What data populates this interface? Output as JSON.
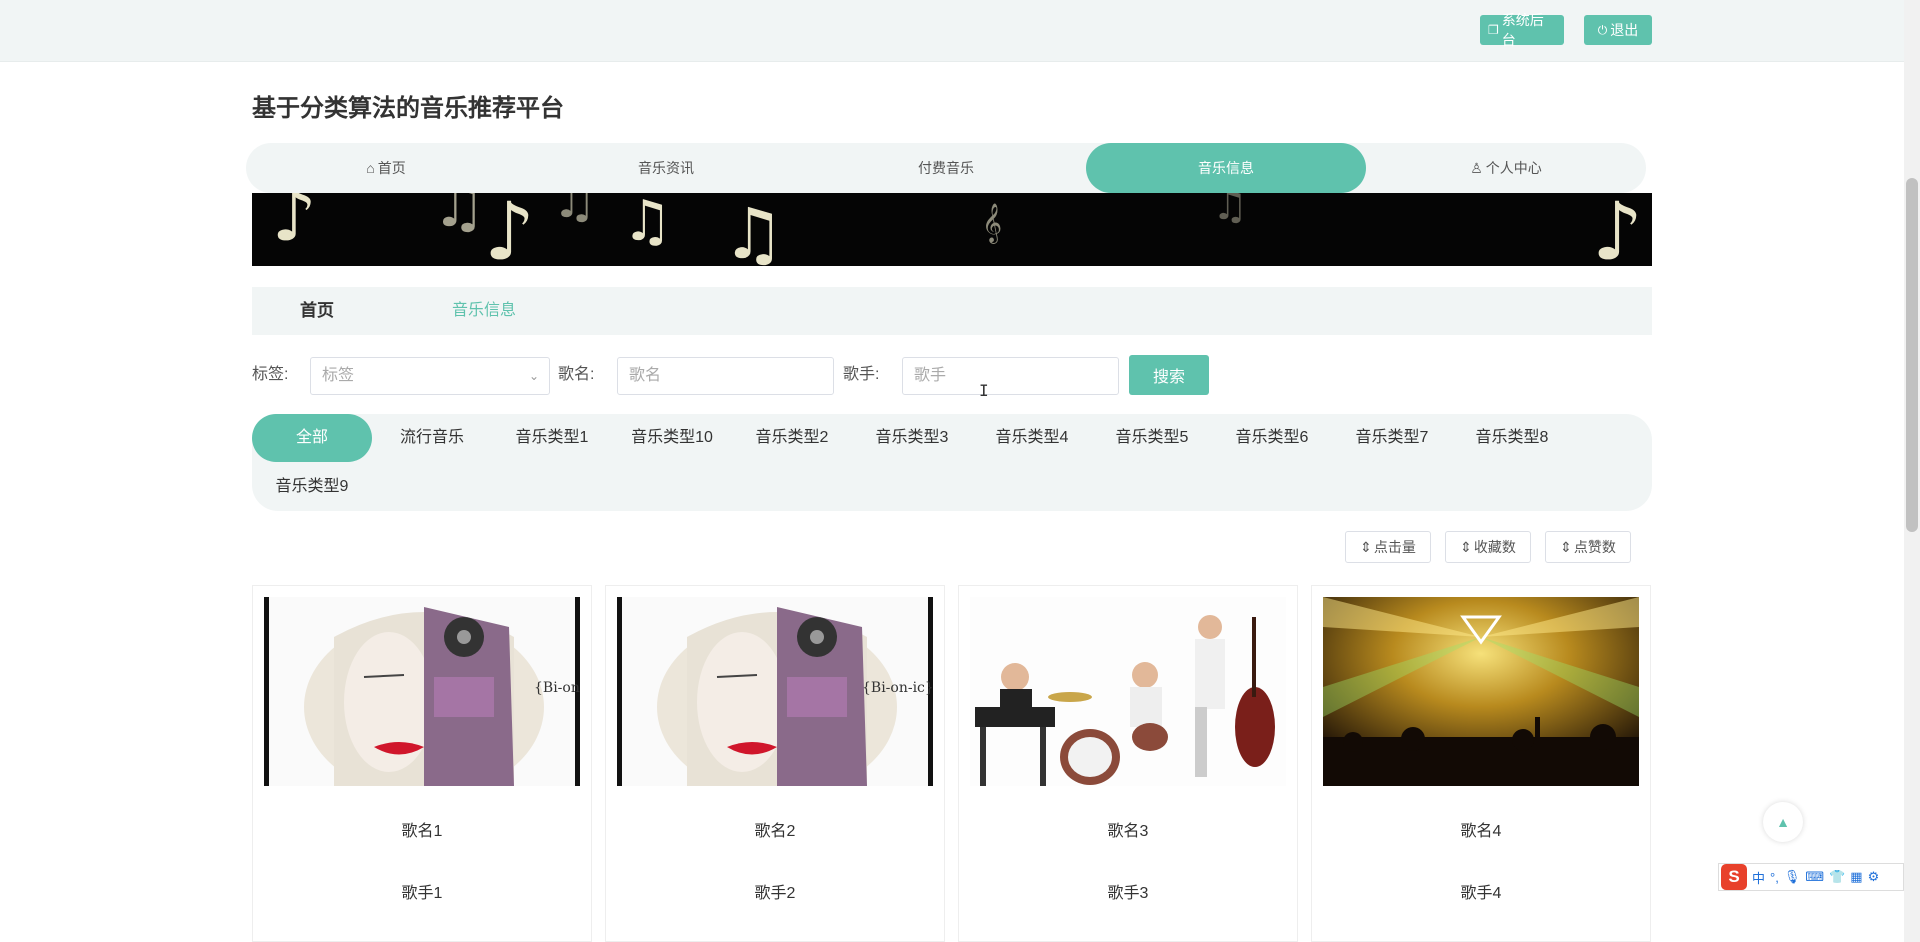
{
  "top": {
    "admin_label": "系统后台",
    "logout_label": "退出"
  },
  "site": {
    "title": "基于分类算法的音乐推荐平台"
  },
  "nav": [
    {
      "label": "首页",
      "icon": "home-icon"
    },
    {
      "label": "音乐资讯"
    },
    {
      "label": "付费音乐"
    },
    {
      "label": "音乐信息",
      "active": true
    },
    {
      "label": "个人中心",
      "icon": "user-icon"
    }
  ],
  "breadcrumb": {
    "home": "首页",
    "current": "音乐信息"
  },
  "filter": {
    "tag_label": "标签:",
    "tag_placeholder": "标签",
    "song_label": "歌名:",
    "song_placeholder": "歌名",
    "singer_label": "歌手:",
    "singer_placeholder": "歌手",
    "search_label": "搜索"
  },
  "categories": [
    "全部",
    "流行音乐",
    "音乐类型1",
    "音乐类型10",
    "音乐类型2",
    "音乐类型3",
    "音乐类型4",
    "音乐类型5",
    "音乐类型6",
    "音乐类型7",
    "音乐类型8",
    "音乐类型9"
  ],
  "sort": {
    "clicks": "点击量",
    "favorites": "收藏数",
    "likes": "点赞数"
  },
  "cards": [
    {
      "name": "歌名1",
      "singer": "歌手1",
      "image": "bionic-album-cover"
    },
    {
      "name": "歌名2",
      "singer": "歌手2",
      "image": "bionic-album-cover"
    },
    {
      "name": "歌名3",
      "singer": "歌手3",
      "image": "band-photo"
    },
    {
      "name": "歌名4",
      "singer": "歌手4",
      "image": "concert-photo"
    }
  ],
  "ime": {
    "lang": "中"
  },
  "colors": {
    "accent": "#5fc2ad",
    "panel": "#f1f5f5"
  }
}
